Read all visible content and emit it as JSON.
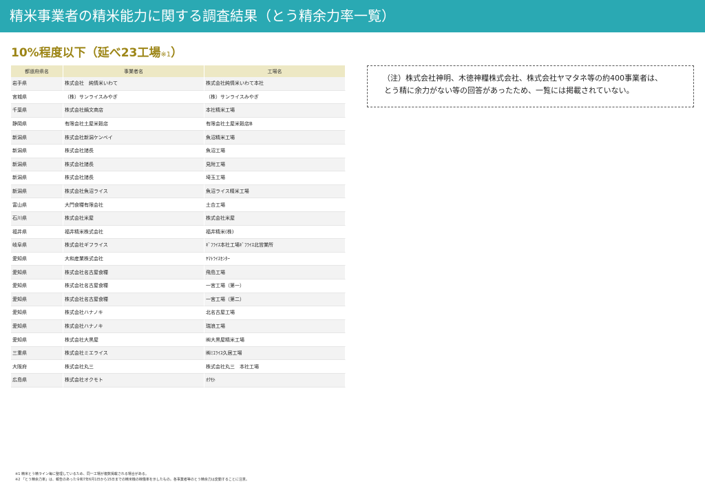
{
  "header": {
    "title": "精米事業者の精米能力に関する調査結果（とう精余力率一覧）"
  },
  "section": {
    "title": "10%程度以下（延べ23工場",
    "note_mark": "※1",
    "close": "）"
  },
  "table": {
    "columns": [
      "都道府県名",
      "事業者名",
      "工場名"
    ],
    "rows": [
      [
        "岩手県",
        "株式会社　純情米いわて",
        "株式会社純情米いわて本社"
      ],
      [
        "宮城県",
        "（株）サンライスみやぎ",
        "（株）サンライスみやぎ"
      ],
      [
        "千葉県",
        "株式会社鍋文商店",
        "本社精米工場"
      ],
      [
        "静岡県",
        "有限会社土屋米穀店",
        "有限会社土屋米穀店B"
      ],
      [
        "新潟県",
        "株式会社新潟ケンベイ",
        "魚沼精米工場"
      ],
      [
        "新潟県",
        "株式会社諸長",
        "魚沼工場"
      ],
      [
        "新潟県",
        "株式会社諸長",
        "見附工場"
      ],
      [
        "新潟県",
        "株式会社諸長",
        "埼玉工場"
      ],
      [
        "新潟県",
        "株式会社魚沼ライス",
        "魚沼ライス精米工場"
      ],
      [
        "富山県",
        "大門食糧有限会社",
        "土合工場"
      ],
      [
        "石川県",
        "株式会社米屋",
        "株式会社米屋"
      ],
      [
        "福井県",
        "福井精米株式会社",
        "福井精米(株)"
      ],
      [
        "岐阜県",
        "株式会社ギフライス",
        "ｷﾞﾌﾗｲｽ本社工場ｷﾞﾌﾗｲｽ北営業所"
      ],
      [
        "愛知県",
        "大和産業株式会社",
        "ﾔﾏﾄﾗｲｽｾﾝﾀｰ"
      ],
      [
        "愛知県",
        "株式会社名古屋食糧",
        "飛島工場"
      ],
      [
        "愛知県",
        "株式会社名古屋食糧",
        "一宮工場（第一）"
      ],
      [
        "愛知県",
        "株式会社名古屋食糧",
        "一宮工場（第二）"
      ],
      [
        "愛知県",
        "株式会社ハナノキ",
        "北名古屋工場"
      ],
      [
        "愛知県",
        "株式会社ハナノキ",
        "瑞浪工場"
      ],
      [
        "愛知県",
        "株式会社大黒屋",
        "㈱大黒屋精米工場"
      ],
      [
        "三重県",
        "株式会社ミエライス",
        "㈱ﾐｴﾗｲｽ久居工場"
      ],
      [
        "大阪府",
        "株式会社丸三",
        "株式会社丸三　本社工場"
      ],
      [
        "広島県",
        "株式会社オクモト",
        "ｵｸﾓﾄ"
      ]
    ]
  },
  "notice": {
    "line1": "（注）株式会社神明、木徳神糧株式会社、株式会社ヤマタネ等の約400事業者は、",
    "line2": "とう精に余力がない等の回答があったため、一覧には掲載されていない。"
  },
  "footnotes": {
    "note1": "※1 精米とう精ライン毎に整理しているため、同一工場が複数掲載される場合がある。",
    "note2": "※2 「とう精余力率」は、報告のあった令和7年6月1日から15日までの精米機の稼働率を示したもの。各事業者等のとう精余力は変動することに注意。"
  }
}
